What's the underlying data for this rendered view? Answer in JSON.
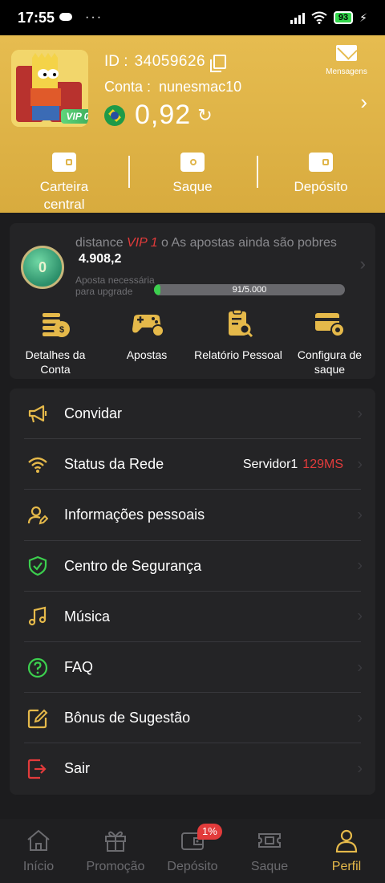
{
  "status_bar": {
    "time": "17:55",
    "dots": "···",
    "battery": "93"
  },
  "header": {
    "id_label": "ID :",
    "id_value": "34059626",
    "conta_label": "Conta :",
    "conta_value": "nunesmac10",
    "balance": "0,92",
    "vip_badge": "VIP 0",
    "messages_label": "Mensagens",
    "wallet": [
      {
        "label": "Carteira\ncentral",
        "icon": "wallet-icon"
      },
      {
        "label": "Saque",
        "icon": "ticket-icon"
      },
      {
        "label": "Depósito",
        "icon": "card-icon"
      }
    ]
  },
  "vip": {
    "medal_level": "0",
    "distance_prefix": "distance",
    "next_level": "VIP 1",
    "distance_suffix": "o As apostas ainda são pobres",
    "amount": "4.908,2",
    "aposta_label": "Aposta necessária para upgrade",
    "progress_text": "91/5.000",
    "progress_fraction": 0.0182,
    "quick": [
      {
        "label": "Detalhes da Conta",
        "icon": "account-details-icon"
      },
      {
        "label": "Apostas",
        "icon": "gamepad-icon"
      },
      {
        "label": "Relatório Pessoal",
        "icon": "report-icon"
      },
      {
        "label": "Configura de saque",
        "icon": "withdraw-settings-icon"
      }
    ]
  },
  "menu": [
    {
      "label": "Convidar",
      "icon": "megaphone-icon"
    },
    {
      "label": "Status da Rede",
      "icon": "wifi-icon",
      "server": "Servidor1",
      "ping": "129MS"
    },
    {
      "label": "Informações pessoais",
      "icon": "user-edit-icon"
    },
    {
      "label": "Centro de Segurança",
      "icon": "shield-icon"
    },
    {
      "label": "Música",
      "icon": "music-icon"
    },
    {
      "label": "FAQ",
      "icon": "question-icon"
    },
    {
      "label": "Bônus de Sugestão",
      "icon": "edit-icon"
    },
    {
      "label": "Sair",
      "icon": "logout-icon"
    }
  ],
  "bottom_nav": [
    {
      "label": "Início",
      "icon": "home-icon"
    },
    {
      "label": "Promoção",
      "icon": "gift-icon"
    },
    {
      "label": "Depósito",
      "icon": "wallet-icon",
      "badge": "1%"
    },
    {
      "label": "Saque",
      "icon": "ticket-icon"
    },
    {
      "label": "Perfil",
      "icon": "profile-icon",
      "active": true
    }
  ],
  "colors": {
    "gold": "#e0b54a",
    "accent_red": "#e23b3b",
    "accent_green": "#3ccf4e",
    "background": "#1c1c1e",
    "card": "#242426"
  }
}
